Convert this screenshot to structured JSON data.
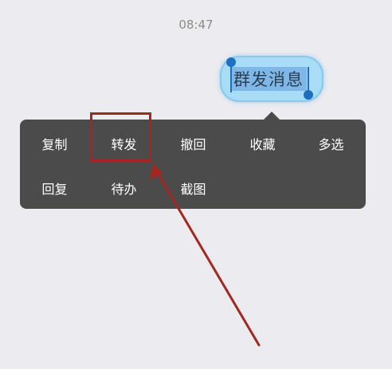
{
  "status": {
    "time": "08:47"
  },
  "message": {
    "text": "群发消息",
    "bubble_color": "#a8dcf7",
    "selection_color": "#7fb8e8"
  },
  "menu": {
    "background": "#4b4b4b",
    "rows": [
      [
        {
          "name": "copy",
          "label": "复制"
        },
        {
          "name": "forward",
          "label": "转发"
        },
        {
          "name": "recall",
          "label": "撤回"
        },
        {
          "name": "favorite",
          "label": "收藏"
        },
        {
          "name": "multi-select",
          "label": "多选"
        }
      ],
      [
        {
          "name": "reply",
          "label": "回复"
        },
        {
          "name": "todo",
          "label": "待办"
        },
        {
          "name": "screenshot",
          "label": "截图"
        }
      ]
    ]
  },
  "annotation": {
    "highlighted_item": "转发",
    "color": "#a2271f"
  }
}
